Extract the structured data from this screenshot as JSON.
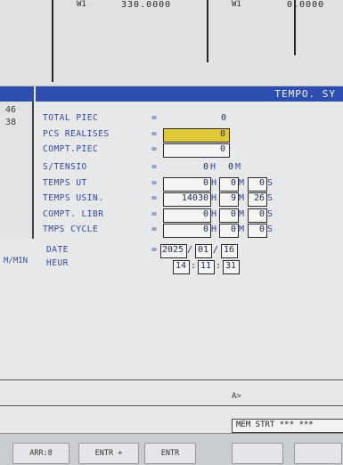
{
  "top": {
    "left_value": "330.0000",
    "right_value": "0.0000",
    "marks": [
      "W1",
      "W1"
    ]
  },
  "title": "TEMPO. SY",
  "left_panel": {
    "values": [
      "46",
      "38"
    ],
    "label": "M/MIN"
  },
  "rows": [
    {
      "label": "TOTAL PIEC",
      "value": "0"
    },
    {
      "label": "PCS REALISES",
      "value": "0"
    },
    {
      "label": "COMPT.PIEC",
      "value": "0"
    },
    {
      "label": "S/TENSIO",
      "h": "0",
      "m": "0"
    },
    {
      "label": "TEMPS UT",
      "h": "0",
      "m": "0",
      "s": "0"
    },
    {
      "label": "TEMPS USIN.",
      "h": "14030",
      "m": "9",
      "s": "26"
    },
    {
      "label": "COMPT. LIBR",
      "h": "0",
      "m": "0",
      "s": "0"
    },
    {
      "label": "TMPS CYCLE",
      "h": "0",
      "m": "0",
      "s": "0"
    }
  ],
  "units": {
    "h": "H",
    "m": "M",
    "s": "S"
  },
  "date": {
    "label": "DATE",
    "year": "2025",
    "month": "01",
    "day": "16"
  },
  "time": {
    "label": "HEUR",
    "h": "14",
    "m": "11",
    "s": "31"
  },
  "sep_eq": "=",
  "sep_slash": "/",
  "sep_colon": ":",
  "prompt": "A>",
  "status": "MEM STRT *** ***",
  "softkeys": [
    "ARR:8",
    "ENTR +",
    "ENTR",
    "",
    ""
  ]
}
